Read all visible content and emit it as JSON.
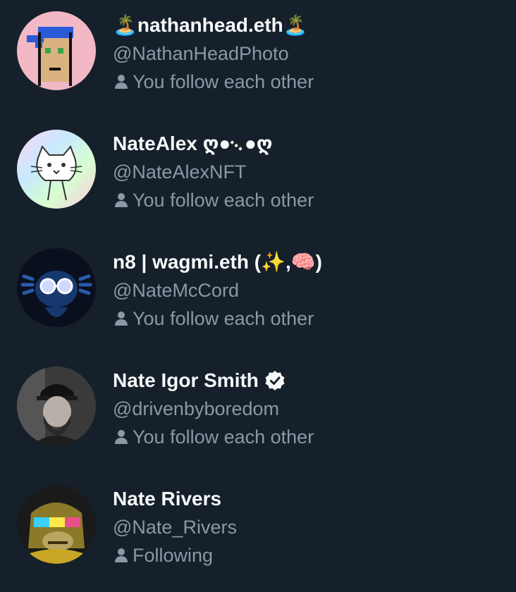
{
  "users": [
    {
      "name_prefix": "🏝️",
      "name": "nathanhead.eth",
      "name_suffix": "🏝️",
      "handle": "@NathanHeadPhoto",
      "relation": "You follow each other",
      "avatar_icon": "cryptopunk-avatar",
      "avatar_bg": "#f2b8c6"
    },
    {
      "name": "NateAlex",
      "name_suffix": "ღ●᨞●ღ",
      "handle": "@NateAlexNFT",
      "relation": "You follow each other",
      "avatar_icon": "holographic-cat-avatar",
      "avatar_bg": "#e8e0ff"
    },
    {
      "name": "n8 | wagmi.eth (",
      "name_emoji_1": "✨",
      "name_mid": ",",
      "name_emoji_2": "🧠",
      "name_end": ")",
      "handle": "@NateMcCord",
      "relation": "You follow each other",
      "avatar_icon": "axolotl-avatar",
      "avatar_bg": "#0a0f1e"
    },
    {
      "name": "Nate Igor Smith",
      "handle": "@drivenbyboredom",
      "relation": "You follow each other",
      "verified": true,
      "avatar_icon": "photo-avatar",
      "avatar_bg": "#3a3a3a"
    },
    {
      "name": "Nate Rivers",
      "handle": "@Nate_Rivers",
      "relation": "Following",
      "avatar_icon": "ape-avatar",
      "avatar_bg": "#1a1a1a"
    }
  ],
  "colors": {
    "background": "#15202b",
    "name": "#f7f9f9",
    "secondary": "#8b98a5"
  }
}
